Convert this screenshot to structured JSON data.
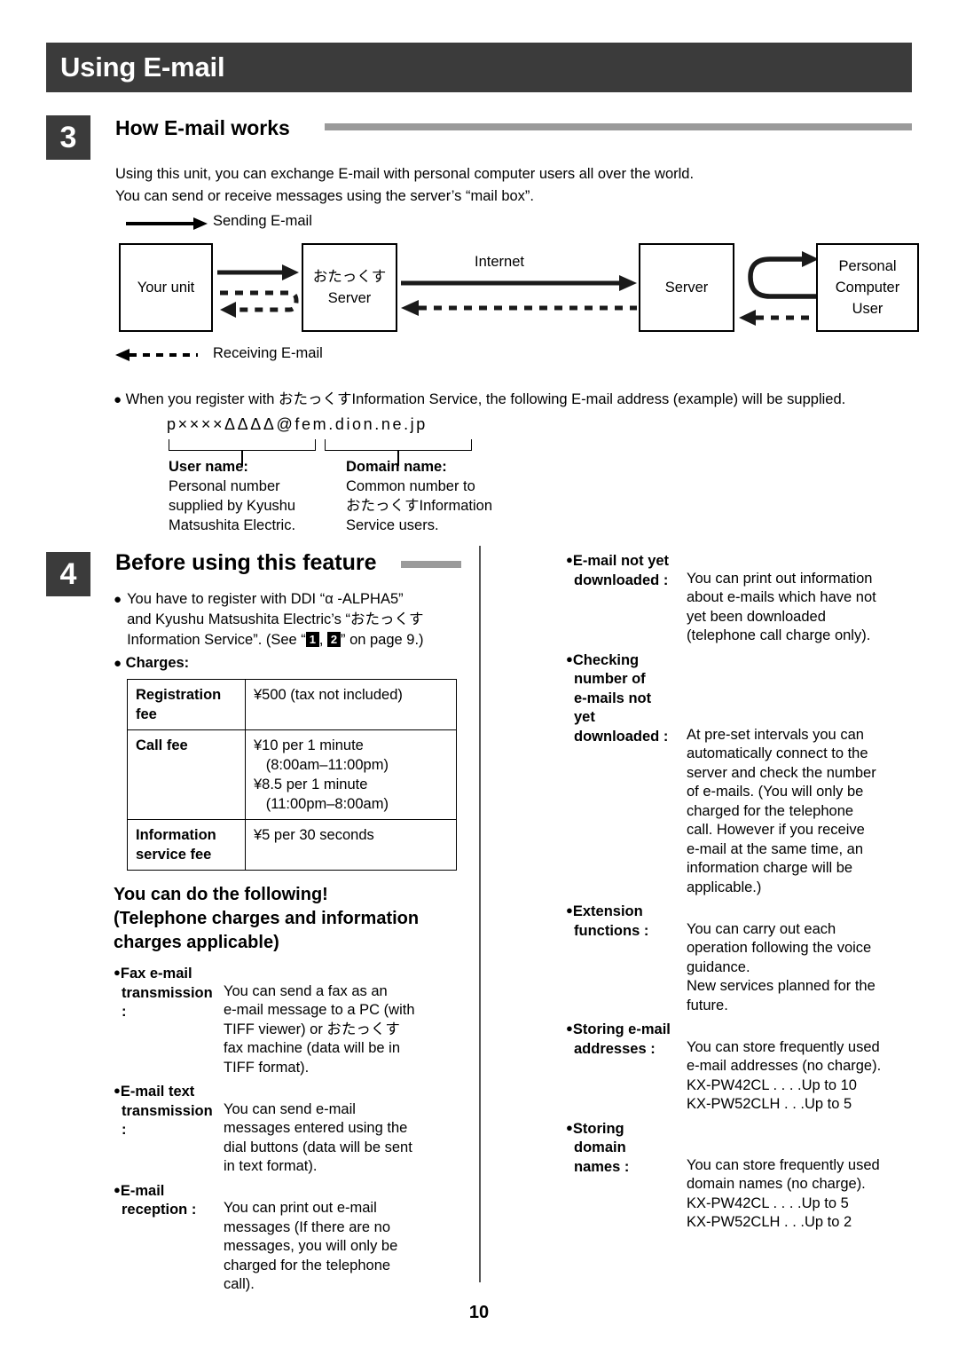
{
  "header": {
    "title": "Using E-mail"
  },
  "section3": {
    "number": "3",
    "heading": "How E-mail works",
    "intro_line1": "Using this unit, you can exchange E-mail with personal computer users all over the world.",
    "intro_line2": "You can send or receive messages using the server’s “mail box”.",
    "diagram": {
      "legend_sending": "Sending E-mail",
      "legend_receiving": "Receiving E-mail",
      "box_your_unit": "Your unit",
      "box_otax_line1": "おたっくす",
      "box_otax_line2": "Server",
      "label_internet": "Internet",
      "box_server": "Server",
      "box_pc_line1": "Personal",
      "box_pc_line2": "Computer",
      "box_pc_line3": "User"
    },
    "register_note": "When you register with おたっくすInformation Service, the following E-mail address (example) will be supplied.",
    "address_example": "p××××ΔΔΔΔ@fem.dion.ne.jp",
    "user_name_label": "User name:",
    "user_name_desc_1": "Personal number",
    "user_name_desc_2": "supplied by Kyushu",
    "user_name_desc_3": "Matsushita Electric.",
    "domain_name_label": "Domain name:",
    "domain_name_desc_1": "Common number to",
    "domain_name_desc_2": "おたっくすInformation",
    "domain_name_desc_3": "Service users."
  },
  "section4": {
    "number": "4",
    "heading": "Before using this feature",
    "register_line1": "You have to register with DDI “α -ALPHA5”",
    "register_line2": "and Kyushu Matsushita Electric’s “おたっくす",
    "register_line3_pre": "Information Service”. (See “",
    "register_mark1": "1",
    "register_line3_mid": ", ",
    "register_mark2": "2",
    "register_line3_post": "” on page 9.)",
    "charges_label": "Charges:",
    "charges_table": [
      {
        "key": "Registration fee",
        "value": "¥500 (tax not included)"
      },
      {
        "key": "Call fee",
        "value": "¥10 per 1 minute\n   (8:00am–11:00pm)\n¥8.5 per 1 minute\n   (11:00pm–8:00am)"
      },
      {
        "key": "Information service fee",
        "value": "¥5 per 30 seconds"
      }
    ],
    "subhead_line1": "You can do the following!",
    "subhead_line2": "(Telephone charges and information",
    "subhead_line3": "charges applicable)",
    "features_left": [
      {
        "term_line1": "Fax e-mail",
        "term_line2": "transmission :",
        "desc": "You can send a fax as an\ne-mail message to a PC (with\nTIFF viewer) or おたっくす\nfax machine (data will be in\nTIFF format)."
      },
      {
        "term_line1": "E-mail text",
        "term_line2": "transmission :",
        "desc": "You can send e-mail\nmessages entered using the\ndial buttons (data will be sent\nin text format)."
      },
      {
        "term_line1": "E-mail",
        "term_line2": "reception :",
        "desc": "You can print out e-mail\nmessages (If there are no\nmessages, you will only be\ncharged for the telephone\ncall)."
      }
    ],
    "features_right": [
      {
        "term_line1": "E-mail not yet",
        "term_line2": "downloaded :",
        "desc": "You can print out information\nabout e-mails which have not\nyet been downloaded\n(telephone call charge only)."
      },
      {
        "term_line1": "Checking",
        "term_line2": "number of",
        "term_line3": "e-mails not",
        "term_line4": "yet",
        "term_line5": "downloaded :",
        "desc": "At pre-set intervals you can\nautomatically connect to the\nserver and check the number\nof e-mails. (You will only be\ncharged for the telephone\ncall. However if you receive\ne-mail at the same time, an\ninformation charge will be\napplicable.)"
      },
      {
        "term_line1": "Extension",
        "term_line2": "functions :",
        "desc": "You can carry out each\noperation following the voice\nguidance.\nNew services planned for the\nfuture."
      },
      {
        "term_line1": "Storing e-mail",
        "term_line2": "addresses :",
        "desc": "You can store frequently used\ne-mail addresses (no charge).\nKX-PW42CL  . . . .Up to 10\nKX-PW52CLH  . . .Up to 5"
      },
      {
        "term_line1": "Storing",
        "term_line2": "domain",
        "term_line3": "names :",
        "desc": "You can store frequently used\ndomain names (no charge).\nKX-PW42CL  . . . .Up to 5\nKX-PW52CLH  . . .Up to 2"
      }
    ]
  },
  "footer": {
    "page_number": "10"
  }
}
